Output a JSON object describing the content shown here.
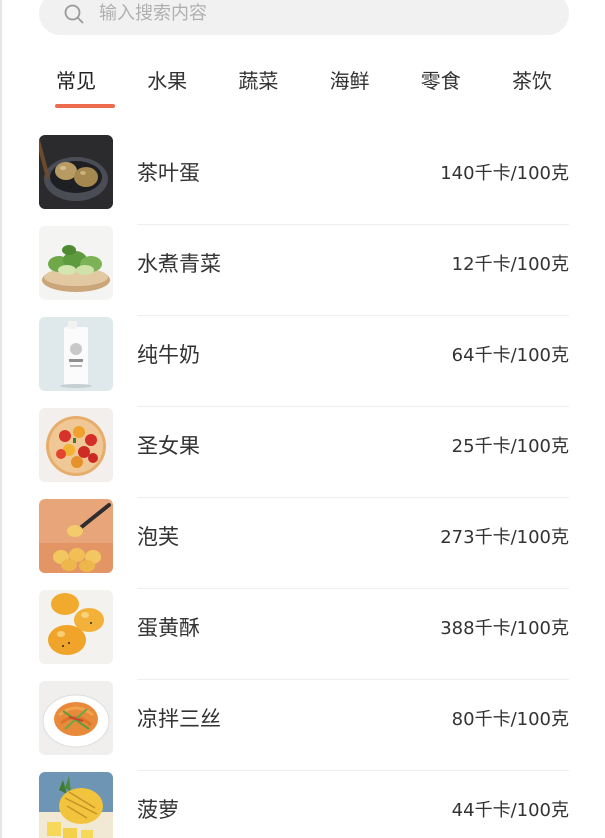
{
  "search": {
    "placeholder": "输入搜索内容",
    "value": ""
  },
  "tabs": [
    {
      "label": "常见",
      "active": true
    },
    {
      "label": "水果",
      "active": false
    },
    {
      "label": "蔬菜",
      "active": false
    },
    {
      "label": "海鲜",
      "active": false
    },
    {
      "label": "零食",
      "active": false
    },
    {
      "label": "茶饮",
      "active": false
    }
  ],
  "accent_color": "#ee6b4d",
  "foods": [
    {
      "name": "茶叶蛋",
      "calories": "140千卡/100克",
      "thumb_icon": "tea-egg-image"
    },
    {
      "name": "水煮青菜",
      "calories": "12千卡/100克",
      "thumb_icon": "boiled-greens-image"
    },
    {
      "name": "纯牛奶",
      "calories": "64千卡/100克",
      "thumb_icon": "milk-carton-image"
    },
    {
      "name": "圣女果",
      "calories": "25千卡/100克",
      "thumb_icon": "cherry-tomato-image"
    },
    {
      "name": "泡芙",
      "calories": "273千卡/100克",
      "thumb_icon": "cream-puff-image"
    },
    {
      "name": "蛋黄酥",
      "calories": "388千卡/100克",
      "thumb_icon": "yolk-pastry-image"
    },
    {
      "name": "凉拌三丝",
      "calories": "80千卡/100克",
      "thumb_icon": "shredded-salad-image"
    },
    {
      "name": "菠萝",
      "calories": "44千卡/100克",
      "thumb_icon": "pineapple-image"
    }
  ]
}
